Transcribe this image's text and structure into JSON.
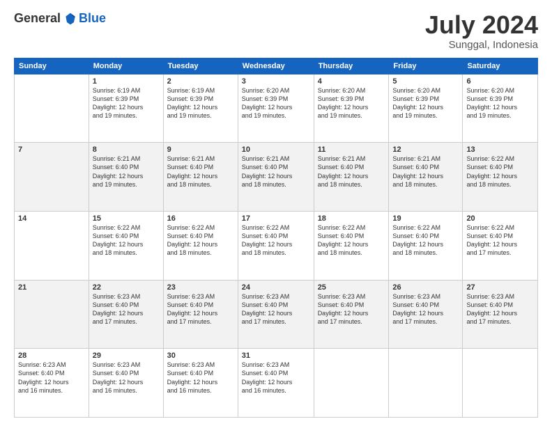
{
  "header": {
    "logo_general": "General",
    "logo_blue": "Blue",
    "month_year": "July 2024",
    "location": "Sunggal, Indonesia"
  },
  "days_of_week": [
    "Sunday",
    "Monday",
    "Tuesday",
    "Wednesday",
    "Thursday",
    "Friday",
    "Saturday"
  ],
  "weeks": [
    [
      {
        "day": "",
        "info": ""
      },
      {
        "day": "1",
        "info": "Sunrise: 6:19 AM\nSunset: 6:39 PM\nDaylight: 12 hours\nand 19 minutes."
      },
      {
        "day": "2",
        "info": "Sunrise: 6:19 AM\nSunset: 6:39 PM\nDaylight: 12 hours\nand 19 minutes."
      },
      {
        "day": "3",
        "info": "Sunrise: 6:20 AM\nSunset: 6:39 PM\nDaylight: 12 hours\nand 19 minutes."
      },
      {
        "day": "4",
        "info": "Sunrise: 6:20 AM\nSunset: 6:39 PM\nDaylight: 12 hours\nand 19 minutes."
      },
      {
        "day": "5",
        "info": "Sunrise: 6:20 AM\nSunset: 6:39 PM\nDaylight: 12 hours\nand 19 minutes."
      },
      {
        "day": "6",
        "info": "Sunrise: 6:20 AM\nSunset: 6:39 PM\nDaylight: 12 hours\nand 19 minutes."
      }
    ],
    [
      {
        "day": "7",
        "info": ""
      },
      {
        "day": "8",
        "info": "Sunrise: 6:21 AM\nSunset: 6:40 PM\nDaylight: 12 hours\nand 19 minutes."
      },
      {
        "day": "9",
        "info": "Sunrise: 6:21 AM\nSunset: 6:40 PM\nDaylight: 12 hours\nand 18 minutes."
      },
      {
        "day": "10",
        "info": "Sunrise: 6:21 AM\nSunset: 6:40 PM\nDaylight: 12 hours\nand 18 minutes."
      },
      {
        "day": "11",
        "info": "Sunrise: 6:21 AM\nSunset: 6:40 PM\nDaylight: 12 hours\nand 18 minutes."
      },
      {
        "day": "12",
        "info": "Sunrise: 6:21 AM\nSunset: 6:40 PM\nDaylight: 12 hours\nand 18 minutes."
      },
      {
        "day": "13",
        "info": "Sunrise: 6:22 AM\nSunset: 6:40 PM\nDaylight: 12 hours\nand 18 minutes."
      }
    ],
    [
      {
        "day": "14",
        "info": ""
      },
      {
        "day": "15",
        "info": "Sunrise: 6:22 AM\nSunset: 6:40 PM\nDaylight: 12 hours\nand 18 minutes."
      },
      {
        "day": "16",
        "info": "Sunrise: 6:22 AM\nSunset: 6:40 PM\nDaylight: 12 hours\nand 18 minutes."
      },
      {
        "day": "17",
        "info": "Sunrise: 6:22 AM\nSunset: 6:40 PM\nDaylight: 12 hours\nand 18 minutes."
      },
      {
        "day": "18",
        "info": "Sunrise: 6:22 AM\nSunset: 6:40 PM\nDaylight: 12 hours\nand 18 minutes."
      },
      {
        "day": "19",
        "info": "Sunrise: 6:22 AM\nSunset: 6:40 PM\nDaylight: 12 hours\nand 18 minutes."
      },
      {
        "day": "20",
        "info": "Sunrise: 6:22 AM\nSunset: 6:40 PM\nDaylight: 12 hours\nand 17 minutes."
      }
    ],
    [
      {
        "day": "21",
        "info": ""
      },
      {
        "day": "22",
        "info": "Sunrise: 6:23 AM\nSunset: 6:40 PM\nDaylight: 12 hours\nand 17 minutes."
      },
      {
        "day": "23",
        "info": "Sunrise: 6:23 AM\nSunset: 6:40 PM\nDaylight: 12 hours\nand 17 minutes."
      },
      {
        "day": "24",
        "info": "Sunrise: 6:23 AM\nSunset: 6:40 PM\nDaylight: 12 hours\nand 17 minutes."
      },
      {
        "day": "25",
        "info": "Sunrise: 6:23 AM\nSunset: 6:40 PM\nDaylight: 12 hours\nand 17 minutes."
      },
      {
        "day": "26",
        "info": "Sunrise: 6:23 AM\nSunset: 6:40 PM\nDaylight: 12 hours\nand 17 minutes."
      },
      {
        "day": "27",
        "info": "Sunrise: 6:23 AM\nSunset: 6:40 PM\nDaylight: 12 hours\nand 17 minutes."
      }
    ],
    [
      {
        "day": "28",
        "info": "Sunrise: 6:23 AM\nSunset: 6:40 PM\nDaylight: 12 hours\nand 16 minutes."
      },
      {
        "day": "29",
        "info": "Sunrise: 6:23 AM\nSunset: 6:40 PM\nDaylight: 12 hours\nand 16 minutes."
      },
      {
        "day": "30",
        "info": "Sunrise: 6:23 AM\nSunset: 6:40 PM\nDaylight: 12 hours\nand 16 minutes."
      },
      {
        "day": "31",
        "info": "Sunrise: 6:23 AM\nSunset: 6:40 PM\nDaylight: 12 hours\nand 16 minutes."
      },
      {
        "day": "",
        "info": ""
      },
      {
        "day": "",
        "info": ""
      },
      {
        "day": "",
        "info": ""
      }
    ]
  ]
}
